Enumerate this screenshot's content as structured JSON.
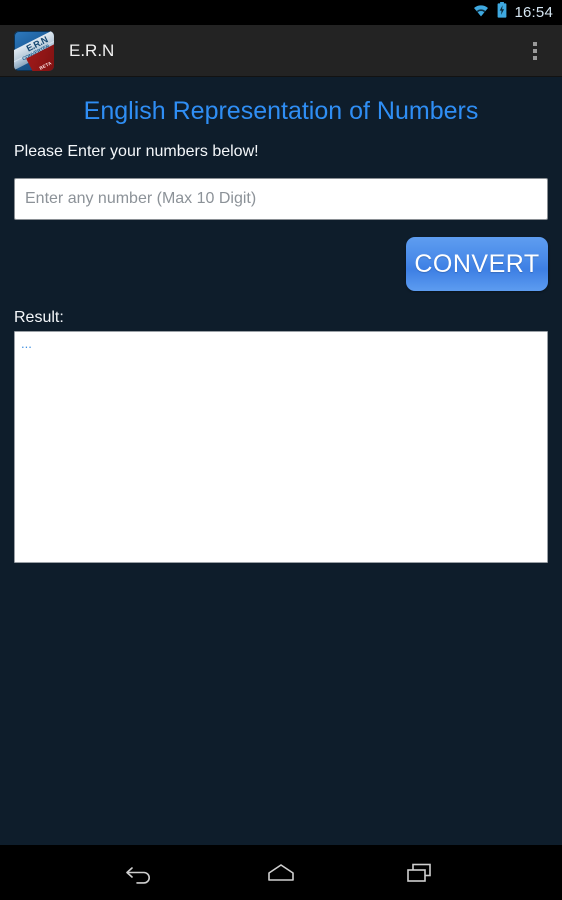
{
  "status_bar": {
    "time": "16:54",
    "wifi_icon": "wifi-icon",
    "battery_icon": "battery-charging-icon",
    "icon_color": "#3fa9e0",
    "background": "#000000"
  },
  "action_bar": {
    "app_icon": "app-logo-icon",
    "app_icon_text": "E.R.N",
    "app_icon_subtext": "CONVERTER",
    "app_icon_badge": "BETA",
    "title": "E.R.N",
    "overflow_icon": "overflow-menu-icon",
    "background": "#232323"
  },
  "main": {
    "page_title": "English Representation of Numbers",
    "page_title_color": "#2f8ef4",
    "subtitle": "Please Enter your numbers below!",
    "number_input": {
      "value": "",
      "placeholder": "Enter any number (Max 10 Digit)"
    },
    "convert_button_label": "CONVERT",
    "convert_button_color": "#4a8be9",
    "result_label": "Result:",
    "result_text": "...",
    "result_text_color": "#3e8fe0",
    "background": "#0e1d2b"
  },
  "nav_bar": {
    "back_icon": "back-arrow-icon",
    "home_icon": "home-icon",
    "recents_icon": "recent-apps-icon",
    "background": "#000000"
  }
}
